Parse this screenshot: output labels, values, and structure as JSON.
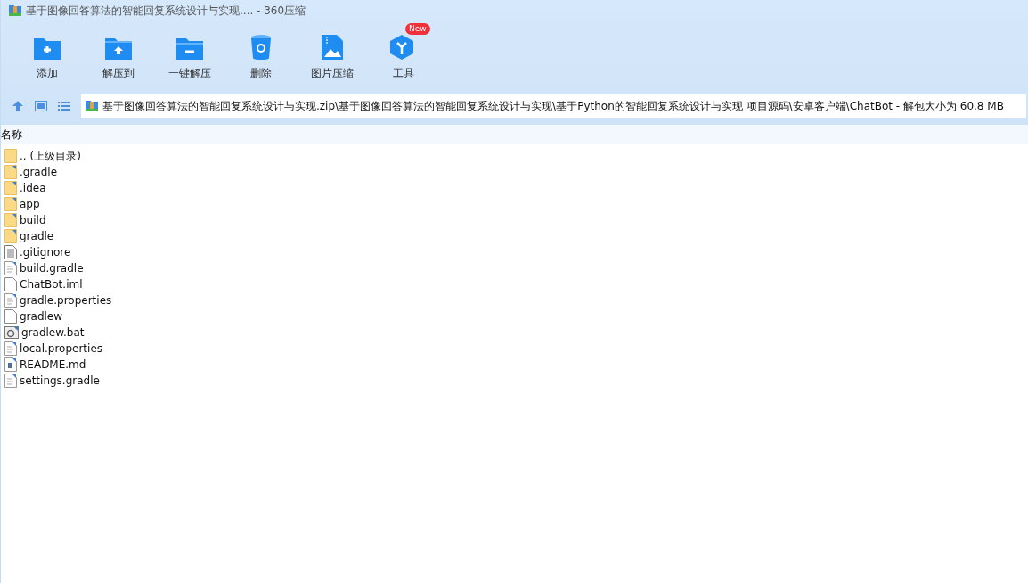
{
  "window": {
    "title": "基于图像回答算法的智能回复系统设计与实现.... - 360压缩"
  },
  "toolbar": [
    {
      "kind": "add",
      "label": "添加"
    },
    {
      "kind": "extract-to",
      "label": "解压到"
    },
    {
      "kind": "extract",
      "label": "一键解压"
    },
    {
      "kind": "delete",
      "label": "删除"
    },
    {
      "kind": "image",
      "label": "图片压缩"
    },
    {
      "kind": "tools",
      "label": "工具",
      "badge": "New"
    }
  ],
  "address_bar": {
    "path": "基于图像回答算法的智能回复系统设计与实现.zip\\基于图像回答算法的智能回复系统设计与实现\\基于Python的智能回复系统设计与实现 项目源码\\安卓客户端\\ChatBot - 解包大小为 60.8 MB"
  },
  "file_list": {
    "column_header": "名称",
    "rows": [
      {
        "kind": "parent",
        "name": ".. (上级目录)"
      },
      {
        "kind": "folder",
        "name": ".gradle"
      },
      {
        "kind": "folder",
        "name": ".idea"
      },
      {
        "kind": "folder",
        "name": "app"
      },
      {
        "kind": "folder",
        "name": "build"
      },
      {
        "kind": "folder",
        "name": "gradle"
      },
      {
        "kind": "text",
        "name": ".gitignore"
      },
      {
        "kind": "doc",
        "name": "build.gradle"
      },
      {
        "kind": "blank",
        "name": "ChatBot.iml"
      },
      {
        "kind": "doc",
        "name": "gradle.properties"
      },
      {
        "kind": "blank",
        "name": "gradlew"
      },
      {
        "kind": "bat",
        "name": "gradlew.bat"
      },
      {
        "kind": "doc",
        "name": "local.properties"
      },
      {
        "kind": "md",
        "name": "README.md"
      },
      {
        "kind": "doc",
        "name": "settings.gradle"
      }
    ]
  }
}
